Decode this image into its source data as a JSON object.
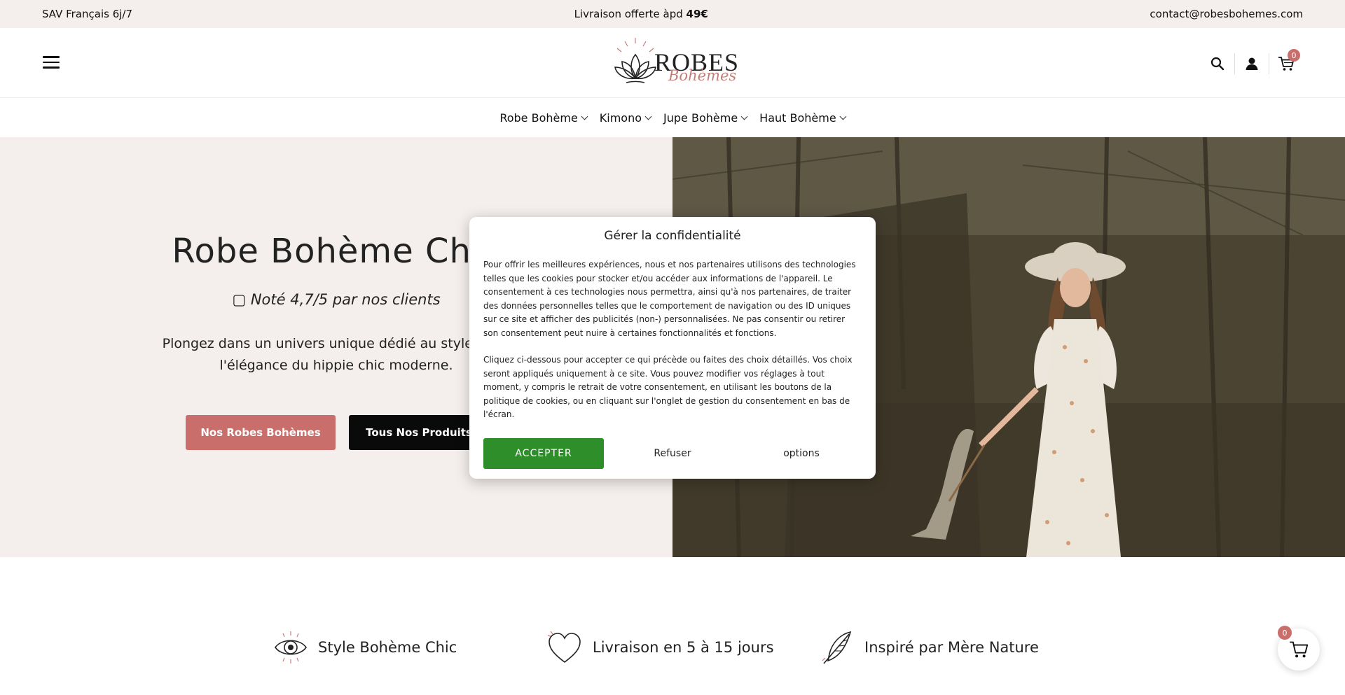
{
  "topbar": {
    "left": "SAV Français 6j/7",
    "center_prefix": "Livraison offerte àpd ",
    "center_bold": "49€",
    "right": "contact@robesbohemes.com"
  },
  "header": {
    "logo_line1": "ROBES",
    "logo_line2": "Bohèmes",
    "cart_count": "0"
  },
  "nav": {
    "items": [
      {
        "label": "Robe Bohème"
      },
      {
        "label": "Kimono"
      },
      {
        "label": "Jupe Bohème"
      },
      {
        "label": "Haut Bohème"
      }
    ]
  },
  "hero": {
    "title": "Robe Bohème Chic",
    "rating": " Noté 4,7/5 par nos clients",
    "description": "Plongez dans un univers unique dédié au style bohè l'élégance du hippie chic moderne.",
    "desc_line1": "Plongez dans un univers unique dédié au style bohè",
    "desc_line2": "l'élégance du hippie chic moderne.",
    "btn_primary": "Nos Robes Bohèmes",
    "btn_secondary": "Tous Nos Produits"
  },
  "cookie_modal": {
    "title": "Gérer la confidentialité",
    "paragraph1": "Pour offrir les meilleures expériences, nous et nos partenaires utilisons des technologies telles que les cookies pour stocker et/ou accéder aux informations de l'appareil. Le consentement à ces technologies nous permettra, ainsi qu'à nos partenaires, de traiter des données personnelles telles que le comportement de navigation ou des ID uniques sur ce site et afficher des publicités (non-) personnalisées. Ne pas consentir ou retirer son consentement peut nuire à certaines fonctionnalités et fonctions.",
    "paragraph2": "Cliquez ci-dessous pour accepter ce qui précède ou faites des choix détaillés. Vos choix seront appliqués uniquement à ce site. Vous pouvez modifier vos réglages à tout moment, y compris le retrait de votre consentement, en utilisant les boutons de la politique de cookies, ou en cliquant sur l'onglet de gestion du consentement en bas de l'écran.",
    "accept": "ACCEPTER",
    "refuse": "Refuser",
    "options": "options"
  },
  "features": [
    {
      "label": "Style Bohème Chic",
      "icon": "eye-icon"
    },
    {
      "label": "Livraison en 5 à 15 jours",
      "icon": "heart-icon"
    },
    {
      "label": "Inspiré par Mère Nature",
      "icon": "feather-icon"
    }
  ],
  "floating_cart": {
    "count": "0"
  },
  "colors": {
    "accent_pink": "#c96e6a",
    "accept_green": "#2e8f2a",
    "hero_bg": "#f4eeec"
  }
}
